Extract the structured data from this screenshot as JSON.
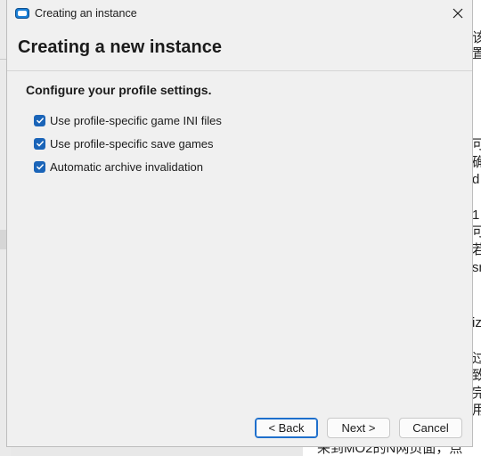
{
  "window": {
    "title": "Creating an instance",
    "heading": "Creating a new instance",
    "subheading": "Configure your profile settings."
  },
  "options": [
    {
      "label": "Use profile-specific game INI files",
      "checked": true
    },
    {
      "label": "Use profile-specific save games",
      "checked": true
    },
    {
      "label": "Automatic archive invalidation",
      "checked": true
    }
  ],
  "buttons": {
    "back": "< Back",
    "next": "Next >",
    "cancel": "Cancel"
  },
  "background": {
    "fragments": [
      "该",
      "置",
      "可",
      "确",
      "d",
      "1",
      "可",
      "若",
      "sr",
      "iz",
      "过",
      "致",
      "完",
      "用",
      "来到MO2的N网页面，点"
    ]
  },
  "colors": {
    "accent": "#1a64b8",
    "window_bg": "#f0f0f0"
  }
}
